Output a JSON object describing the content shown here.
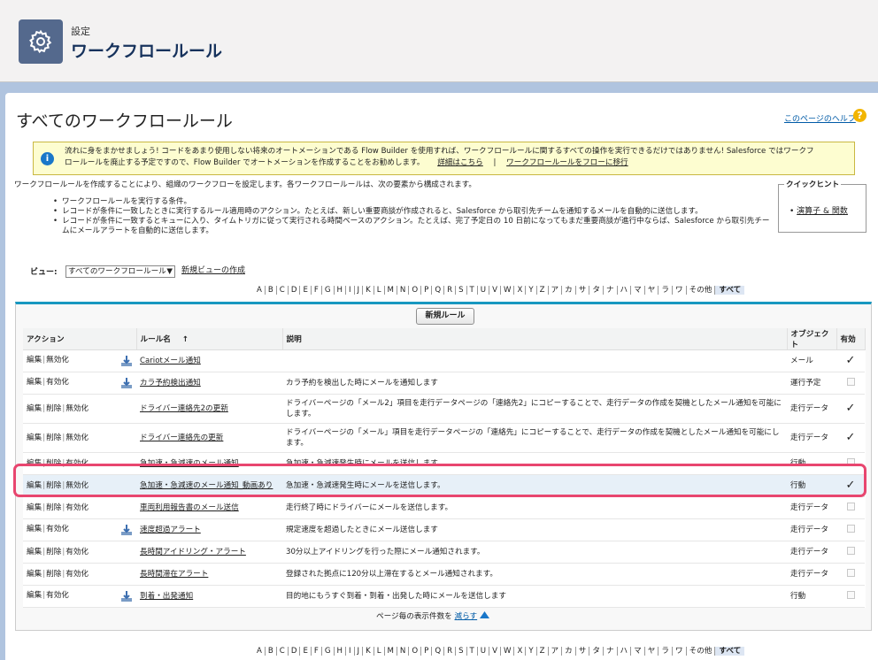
{
  "header": {
    "sup": "設定",
    "title": "ワークフロールール",
    "icon": "gear-icon"
  },
  "page": {
    "title": "すべてのワークフロールール",
    "help": "このページのヘルプ"
  },
  "banner": {
    "text1": "流れに身をまかせましょう! コードをあまり使用しない将来のオートメーションである Flow Builder を使用すれば、ワークフロールールに関するすべての操作を実行できるだけではありません! Salesforce ではワークフ",
    "text2": "ロールールを廃止する予定ですので、Flow Builder でオートメーションを作成することをお勧めします。",
    "link1": "詳細はこちら",
    "sep": "|",
    "link2": "ワークフロールールをフローに移行"
  },
  "intro": "ワークフロールールを作成することにより、組織のワークフローを設定します。各ワークフロールールは、次の要素から構成されます。",
  "bullets": [
    "ワークフロールールを実行する条件。",
    "レコードが条件に一致したときに実行するルール適用時のアクション。たとえば、新しい重要商談が作成されると、Salesforce から取引先チームを通知するメールを自動的に送信します。",
    "レコードが条件に一致するとキューに入り、タイムトリガに従って実行される時間ベースのアクション。たとえば、完了予定日の 10 日前になってもまだ重要商談が進行中ならば、Salesforce から取引先チームにメールアラートを自動的に送信します。"
  ],
  "quick": {
    "title": "クイックヒント",
    "link": "演算子 & 関数"
  },
  "view": {
    "label": "ビュー:",
    "selected": "すべてのワークフロールール",
    "create": "新規ビューの作成"
  },
  "alphabet": [
    "A",
    "B",
    "C",
    "D",
    "E",
    "F",
    "G",
    "H",
    "I",
    "J",
    "K",
    "L",
    "M",
    "N",
    "O",
    "P",
    "Q",
    "R",
    "S",
    "T",
    "U",
    "V",
    "W",
    "X",
    "Y",
    "Z",
    "ア",
    "カ",
    "サ",
    "タ",
    "ナ",
    "ハ",
    "マ",
    "ヤ",
    "ラ",
    "ワ",
    "その他",
    "すべて"
  ],
  "list": {
    "new_button": "新規ルール",
    "columns": {
      "action": "アクション",
      "name": "ルール名",
      "sort": "↑",
      "desc": "説明",
      "object": "オブジェクト",
      "active": "有効"
    },
    "rows": [
      {
        "actions": [
          "編集",
          "無効化"
        ],
        "dl": true,
        "name": "Cariotメール通知",
        "desc": "",
        "object": "メール",
        "active": true
      },
      {
        "actions": [
          "編集",
          "有効化"
        ],
        "dl": true,
        "name": "カラ予約検出通知",
        "desc": "カラ予約を検出した時にメールを通知します",
        "object": "運行予定",
        "active": false
      },
      {
        "actions": [
          "編集",
          "削除",
          "無効化"
        ],
        "dl": false,
        "name": "ドライバー連絡先2の更新",
        "desc": "ドライバーページの「メール2」項目を走行データページの「連絡先2」にコピーすることで、走行データの作成を契機としたメール通知を可能にします。",
        "object": "走行データ",
        "active": true
      },
      {
        "actions": [
          "編集",
          "削除",
          "無効化"
        ],
        "dl": false,
        "name": "ドライバー連絡先の更新",
        "desc": "ドライバーページの「メール」項目を走行データページの「連絡先」にコピーすることで、走行データの作成を契機としたメール通知を可能にします。",
        "object": "走行データ",
        "active": true
      },
      {
        "actions": [
          "編集",
          "削除",
          "有効化"
        ],
        "dl": false,
        "name": "急加速・急減速のメール通知",
        "desc": "急加速・急減速発生時にメールを送信します。",
        "object": "行動",
        "active": false
      },
      {
        "actions": [
          "編集",
          "削除",
          "無効化"
        ],
        "dl": false,
        "name": "急加速・急減速のメール通知_動画あり",
        "desc": "急加速・急減速発生時にメールを送信します。",
        "object": "行動",
        "active": true,
        "highlight": true
      },
      {
        "actions": [
          "編集",
          "削除",
          "有効化"
        ],
        "dl": false,
        "name": "車両利用報告書のメール送信",
        "desc": "走行終了時にドライバーにメールを送信します。",
        "object": "走行データ",
        "active": false
      },
      {
        "actions": [
          "編集",
          "有効化"
        ],
        "dl": true,
        "name": "速度超過アラート",
        "desc": "規定速度を超過したときにメール送信します",
        "object": "走行データ",
        "active": false
      },
      {
        "actions": [
          "編集",
          "削除",
          "有効化"
        ],
        "dl": false,
        "name": "長時間アイドリング・アラート",
        "desc": "30分以上アイドリングを行った際にメール通知されます。",
        "object": "走行データ",
        "active": false
      },
      {
        "actions": [
          "編集",
          "削除",
          "有効化"
        ],
        "dl": false,
        "name": "長時間滞在アラート",
        "desc": "登録された拠点に120分以上滞在するとメール通知されます。",
        "object": "走行データ",
        "active": false
      },
      {
        "actions": [
          "編集",
          "有効化"
        ],
        "dl": true,
        "name": "到着・出発通知",
        "desc": "目的地にもうすぐ到着・到着・出発した時にメールを送信します",
        "object": "行動",
        "active": false
      }
    ]
  },
  "pager": {
    "label": "ページ毎の表示件数を",
    "link": "減らす"
  },
  "colors": {
    "accent": "#1797c0",
    "highlight": "#e8466f",
    "link": "#015ba7"
  }
}
